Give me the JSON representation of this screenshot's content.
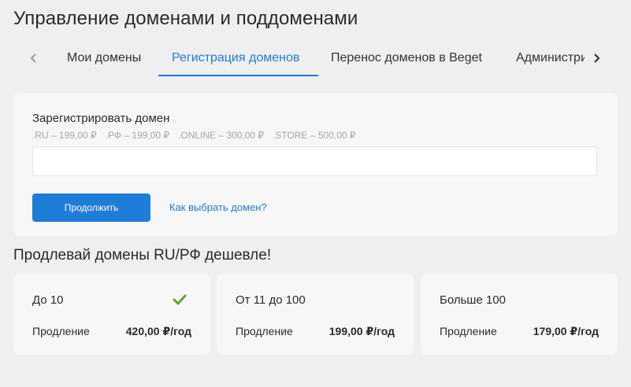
{
  "page": {
    "title": "Управление доменами и поддоменами"
  },
  "tabs": {
    "items": [
      {
        "label": "Мои домены",
        "active": false
      },
      {
        "label": "Регистрация доменов",
        "active": true
      },
      {
        "label": "Перенос доменов в Beget",
        "active": false
      },
      {
        "label": "Администрирование",
        "active": false
      }
    ],
    "prev_icon": "chevron-left-icon",
    "next_icon": "chevron-right-icon"
  },
  "register": {
    "title": "Зарегистрировать домен",
    "prices": [
      ".RU – 199,00 ₽",
      ".РФ – 199,00 ₽",
      ".ONLINE – 300,00 ₽",
      ".STORE – 500,00 ₽"
    ],
    "input_value": "",
    "input_placeholder": "",
    "continue_label": "Продолжить",
    "help_link": "Как выбрать домен?"
  },
  "promo": {
    "title": "Продлевай домены RU/РФ дешевле!",
    "tiers": [
      {
        "name": "До 10",
        "renew_label": "Продление",
        "price": "420,00 ₽/год",
        "selected": true
      },
      {
        "name": "От 11 до 100",
        "renew_label": "Продление",
        "price": "199,00 ₽/год",
        "selected": false
      },
      {
        "name": "Больше 100",
        "renew_label": "Продление",
        "price": "179,00 ₽/год",
        "selected": false
      }
    ]
  },
  "colors": {
    "accent": "#1e7dd6",
    "check": "#5aab2b",
    "background": "#efeff1",
    "card": "#f7f7f8"
  }
}
